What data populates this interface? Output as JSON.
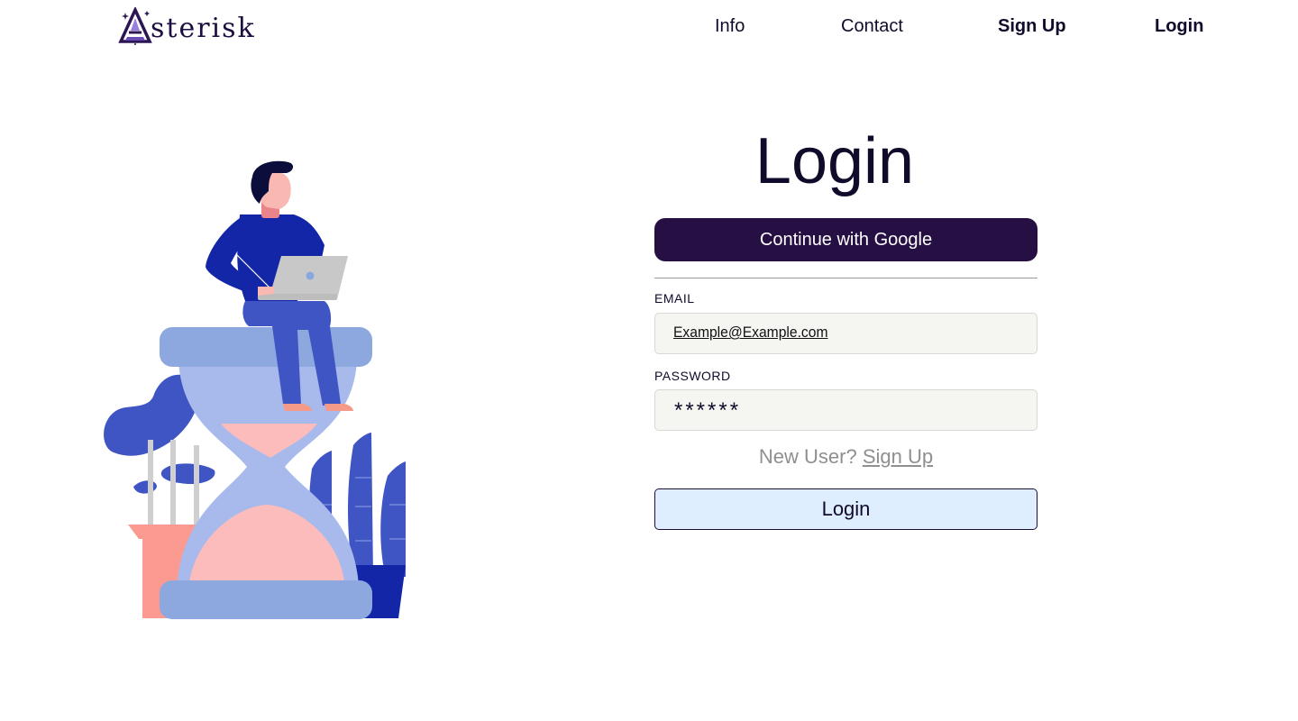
{
  "header": {
    "logo_text": "sterisk",
    "nav": {
      "info": "Info",
      "contact": "Contact",
      "signup": "Sign Up",
      "login": "Login"
    }
  },
  "form": {
    "title": "Login",
    "google_button": "Continue with Google",
    "email_label": "EMAIL",
    "email_value": "Example@Example.com",
    "password_label": "PASSWORD",
    "password_value": "******",
    "new_user_text": "New User?",
    "signup_link": "Sign Up",
    "login_button": "Login"
  },
  "colors": {
    "brand_dark": "#261043",
    "login_button_bg": "#deeefe",
    "input_bg": "#f5f6f2",
    "illustration_blue": "#4055c4",
    "illustration_pink": "#fcbcbc"
  },
  "icons": [
    "asterisk-logo-icon"
  ]
}
